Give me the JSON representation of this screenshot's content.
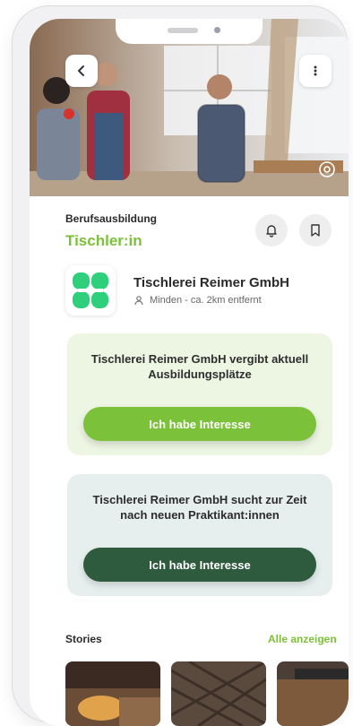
{
  "header": {
    "back_icon": "chevron-left-icon",
    "menu_icon": "more-vertical-icon",
    "camera_icon": "camera-icon"
  },
  "job": {
    "category": "Berufsausbildung",
    "title": "Tischler:in",
    "bell_icon": "bell-icon",
    "bookmark_icon": "bookmark-icon"
  },
  "company": {
    "name": "Tischlerei Reimer GmbH",
    "location": "Minden - ca. 2km entfernt",
    "location_icon": "person-pin-icon"
  },
  "cards": [
    {
      "text": "Tischlerei Reimer GmbH vergibt aktuell Ausbildungsplätze",
      "button": "Ich habe Interesse",
      "accent": "#7cc13a"
    },
    {
      "text": "Tischlerei Reimer GmbH sucht zur Zeit nach neuen Praktikant:innen",
      "button": "Ich habe Interesse",
      "accent": "#2e5a3e"
    }
  ],
  "stories": {
    "title": "Stories",
    "show_all": "Alle anzeigen"
  },
  "colors": {
    "brand_green": "#7cc13a",
    "dark_green": "#2e5a3e",
    "logo_green": "#2fd07c"
  }
}
